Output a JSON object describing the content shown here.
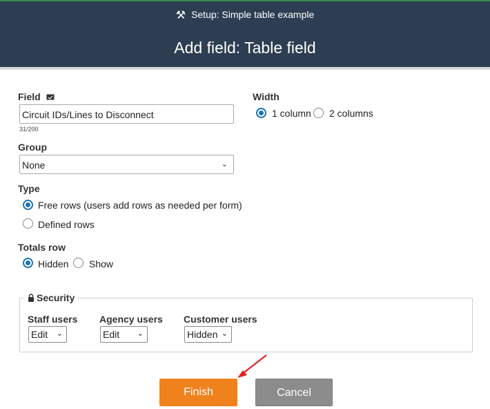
{
  "header": {
    "subtitle": "Setup: Simple table example",
    "title": "Add field: Table field",
    "tools_icon": "tools-icon"
  },
  "field": {
    "label": "Field",
    "value": "Circuit IDs/Lines to Disconnect",
    "counter": "31/200"
  },
  "width": {
    "label": "Width",
    "options": [
      "1 column",
      "2 columns"
    ],
    "selected": "1 column"
  },
  "group": {
    "label": "Group",
    "value": "None"
  },
  "type": {
    "label": "Type",
    "options": [
      "Free rows (users add rows as needed per form)",
      "Defined rows"
    ],
    "selected": "Free rows (users add rows as needed per form)"
  },
  "totals": {
    "label": "Totals row",
    "options": [
      "Hidden",
      "Show"
    ],
    "selected": "Hidden"
  },
  "security": {
    "label": "Security",
    "staff": {
      "label": "Staff users",
      "value": "Edit"
    },
    "agency": {
      "label": "Agency users",
      "value": "Edit"
    },
    "customer": {
      "label": "Customer users",
      "value": "Hidden"
    }
  },
  "buttons": {
    "finish": "Finish",
    "cancel": "Cancel"
  },
  "colors": {
    "header_bg": "#2e3e52",
    "finish": "#f0821e",
    "cancel": "#8c8c8c",
    "radio_on": "#1a73b8",
    "arrow": "#e02020"
  }
}
